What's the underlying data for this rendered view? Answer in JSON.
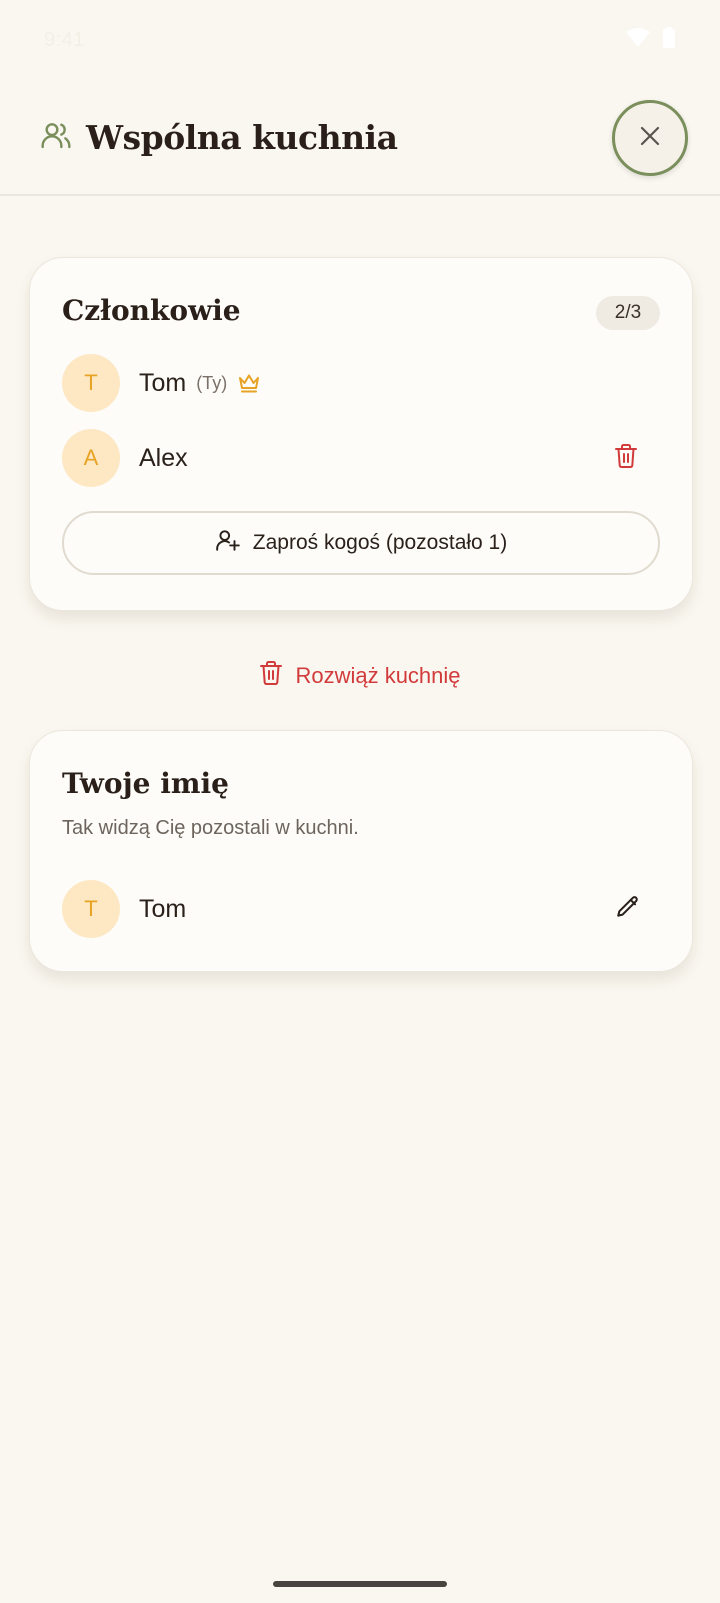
{
  "status_bar": {
    "time": "9:41",
    "wifi_icon": "wifi-icon",
    "battery_icon": "battery-icon"
  },
  "header": {
    "icon": "users-icon",
    "title": "Wspólna kuchnia",
    "close_icon": "close-icon"
  },
  "members_card": {
    "title": "Członkowie",
    "count_badge": "2/3",
    "members": [
      {
        "initial": "T",
        "name": "Tom",
        "you_tag": "(Ty)",
        "owner_icon": "crown-icon"
      },
      {
        "initial": "A",
        "name": "Alex",
        "remove_icon": "trash-icon"
      }
    ],
    "invite_label": "Zaproś kogoś (pozostało 1)",
    "invite_icon": "user-plus-icon"
  },
  "dissolve": {
    "label": "Rozwiąż kuchnię",
    "icon": "trash-icon"
  },
  "name_card": {
    "title": "Twoje imię",
    "subtitle": "Tak widzą Cię pozostali w kuchni.",
    "initial": "T",
    "name": "Tom",
    "edit_icon": "pencil-icon"
  },
  "colors": {
    "background": "#faf7f0",
    "accent_green": "#7a8f5c",
    "avatar_bg": "#fde8c3",
    "avatar_text": "#e8a325",
    "danger": "#d23b3b"
  }
}
